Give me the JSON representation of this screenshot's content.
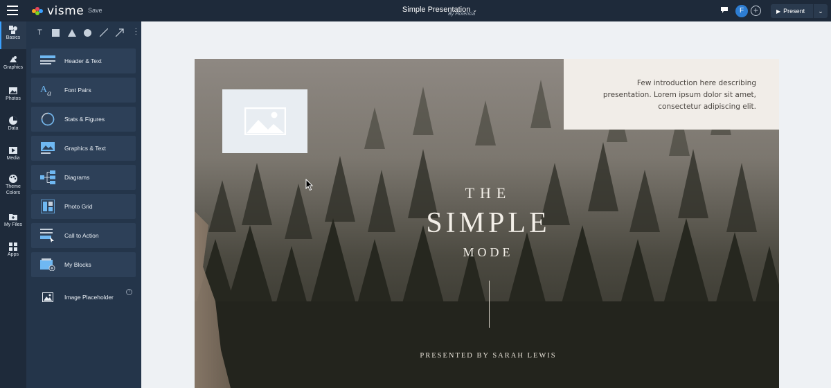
{
  "app": {
    "name": "visme",
    "save_label": "Save"
  },
  "document": {
    "title": "Simple Presentation",
    "author": "By Florencia"
  },
  "user": {
    "avatar_initial": "F"
  },
  "topbar": {
    "add_user_label": "+",
    "present_label": "Present"
  },
  "rail": {
    "items": [
      {
        "label": "Basics",
        "icon": "basics-icon"
      },
      {
        "label": "Graphics",
        "icon": "graphics-icon"
      },
      {
        "label": "Photos",
        "icon": "photos-icon"
      },
      {
        "label": "Data",
        "icon": "data-icon"
      },
      {
        "label": "Media",
        "icon": "media-icon"
      },
      {
        "label": "Theme",
        "label2": "Colors",
        "icon": "palette-icon"
      },
      {
        "label": "My Files",
        "icon": "files-icon"
      },
      {
        "label": "Apps",
        "icon": "apps-icon"
      }
    ]
  },
  "shape_tools": [
    "T",
    "square",
    "triangle",
    "circle",
    "line",
    "arrow"
  ],
  "blocks": [
    {
      "label": "Header & Text",
      "icon": "header-text-icon"
    },
    {
      "label": "Font Pairs",
      "icon": "font-pairs-icon"
    },
    {
      "label": "Stats & Figures",
      "icon": "stats-icon"
    },
    {
      "label": "Graphics & Text",
      "icon": "graphics-text-icon"
    },
    {
      "label": "Diagrams",
      "icon": "diagram-icon"
    },
    {
      "label": "Photo Grid",
      "icon": "photo-grid-icon"
    },
    {
      "label": "Call to Action",
      "icon": "call-to-action-icon"
    },
    {
      "label": "My Blocks",
      "icon": "my-blocks-icon"
    }
  ],
  "image_placeholder": {
    "label": "Image Placeholder",
    "help": "?"
  },
  "slide": {
    "intro_lines": [
      "Few introduction here describing",
      "presentation. Lorem ipsum dolor sit amet,",
      "consectetur adipiscing elit."
    ],
    "title_the": "THE",
    "title_simple": "SIMPLE",
    "title_mode": "MODE",
    "presented_by": "PRESENTED BY SARAH LEWIS"
  },
  "colors": {
    "topbar": "#1e2a3a",
    "panel": "#24354a",
    "block": "#2d4058",
    "accent": "#3aa0ff",
    "intro_box": "#f1ede8"
  }
}
